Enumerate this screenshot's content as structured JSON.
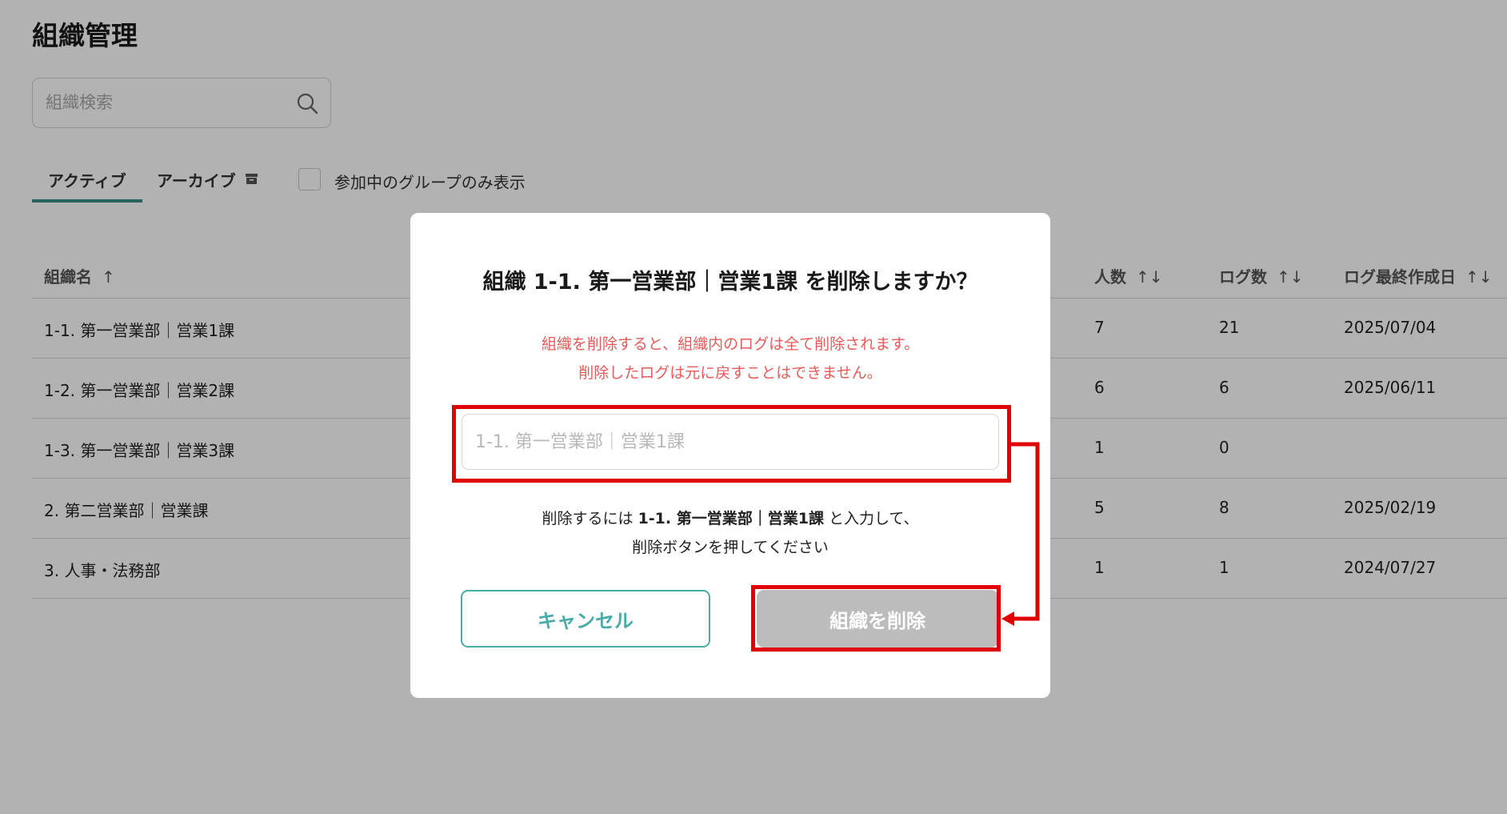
{
  "page": {
    "title": "組織管理",
    "search_placeholder": "組織検索",
    "tabs": [
      {
        "label": "アクティブ",
        "active": true
      },
      {
        "label": "アーカイブ",
        "icon": "archive-icon",
        "active": false
      }
    ],
    "filter_label": "参加中のグループのみ表示",
    "filter_checked": false
  },
  "table": {
    "columns": [
      {
        "label": "組織名",
        "sort": "↑"
      },
      {
        "label": "人数",
        "sort": "↑↓"
      },
      {
        "label": "ログ数",
        "sort": "↑↓"
      },
      {
        "label": "ログ最終作成日",
        "sort": "↑↓"
      }
    ],
    "rows": [
      {
        "name": "1-1. 第一営業部｜営業1課",
        "people": "7",
        "logs": "21",
        "last_log": "2025/07/04"
      },
      {
        "name": "1-2. 第一営業部｜営業2課",
        "people": "6",
        "logs": "6",
        "last_log": "2025/06/11"
      },
      {
        "name": "1-3. 第一営業部｜営業3課",
        "people": "1",
        "logs": "0",
        "last_log": ""
      },
      {
        "name": "2. 第二営業部｜営業課",
        "people": "5",
        "logs": "8",
        "last_log": "2025/02/19"
      },
      {
        "name": "3. 人事・法務部",
        "people": "1",
        "logs": "1",
        "last_log": "2024/07/27"
      }
    ]
  },
  "modal": {
    "title": "組織 1-1. 第一営業部｜営業1課 を削除しますか？",
    "warning_line1": "組織を削除すると、組織内のログは全て削除されます。",
    "warning_line2": "削除したログは元に戻すことはできません。",
    "input_value": "",
    "input_placeholder": "1-1. 第一営業部｜営業1課",
    "instruction_prefix": "削除するには ",
    "instruction_org": "1-1. 第一営業部｜営業1課",
    "instruction_suffix": " と入力して、",
    "instruction_line2": "削除ボタンを押してください",
    "cancel_label": "キャンセル",
    "delete_label": "組織を削除",
    "delete_enabled": false
  },
  "colors": {
    "accent": "#4aaca6",
    "tab_underline": "#3a8f8a",
    "warning": "#e85a5a",
    "disabled_button": "#bcbcbc",
    "highlight": "#e10000"
  }
}
